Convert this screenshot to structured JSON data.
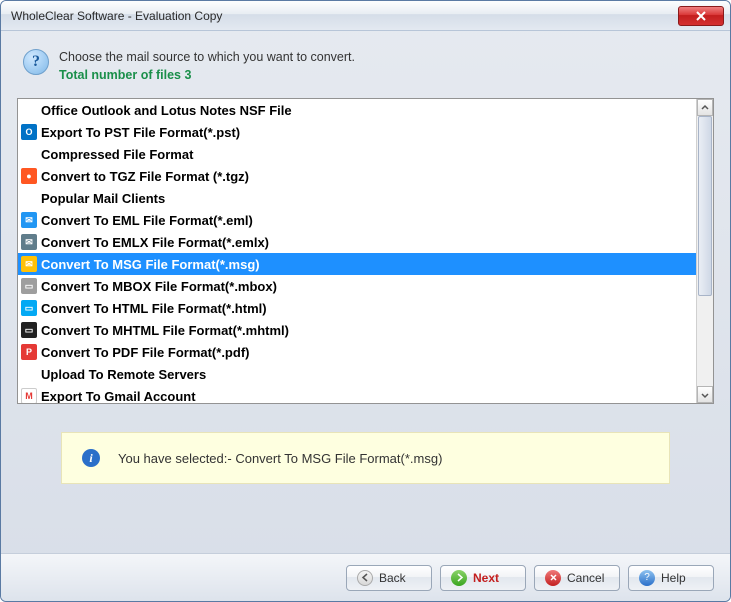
{
  "window": {
    "title": "WholeClear Software - Evaluation Copy"
  },
  "intro": {
    "line1": "Choose the mail source to which you want to convert.",
    "file_count_label": "Total number of files 3"
  },
  "list": [
    {
      "type": "header",
      "label": "Office Outlook and Lotus Notes NSF File"
    },
    {
      "type": "item",
      "icon": "ic-outlook",
      "icon_text": "O",
      "label": "Export To PST File Format(*.pst)"
    },
    {
      "type": "header",
      "label": "Compressed File Format"
    },
    {
      "type": "item",
      "icon": "ic-tgz",
      "icon_text": "●",
      "label": "Convert to TGZ File Format (*.tgz)"
    },
    {
      "type": "header",
      "label": "Popular Mail Clients"
    },
    {
      "type": "item",
      "icon": "ic-eml",
      "icon_text": "✉",
      "label": "Convert To EML File Format(*.eml)"
    },
    {
      "type": "item",
      "icon": "ic-emlx",
      "icon_text": "✉",
      "label": "Convert To EMLX File Format(*.emlx)"
    },
    {
      "type": "item",
      "icon": "ic-msg",
      "icon_text": "✉",
      "label": "Convert To MSG File Format(*.msg)",
      "selected": true
    },
    {
      "type": "item",
      "icon": "ic-mbox",
      "icon_text": "▭",
      "label": "Convert To MBOX File Format(*.mbox)"
    },
    {
      "type": "item",
      "icon": "ic-html",
      "icon_text": "▭",
      "label": "Convert To HTML File Format(*.html)"
    },
    {
      "type": "item",
      "icon": "ic-mhtml",
      "icon_text": "▭",
      "label": "Convert To MHTML File Format(*.mhtml)"
    },
    {
      "type": "item",
      "icon": "ic-pdf",
      "icon_text": "P",
      "label": "Convert To PDF File Format(*.pdf)"
    },
    {
      "type": "header",
      "label": "Upload To Remote Servers"
    },
    {
      "type": "item",
      "icon": "ic-gmail",
      "icon_text": "M",
      "label": "Export To Gmail Account"
    }
  ],
  "status": {
    "prefix": "You have selected:- ",
    "value": "Convert To MSG File Format(*.msg)"
  },
  "buttons": {
    "back": "Back",
    "next": "Next",
    "cancel": "Cancel",
    "help": "Help"
  }
}
